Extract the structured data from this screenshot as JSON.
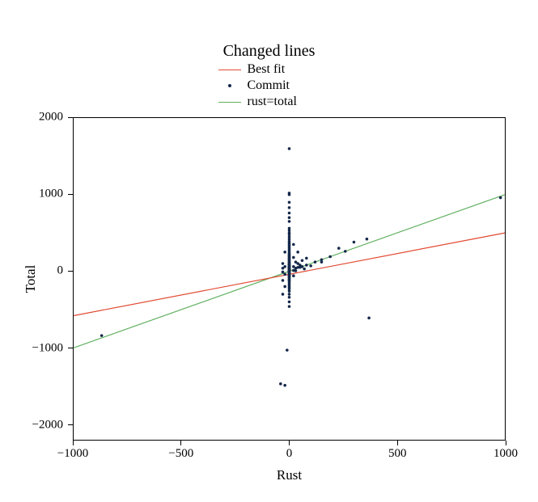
{
  "chart_data": {
    "type": "scatter",
    "title": "Changed lines",
    "xlabel": "Rust",
    "ylabel": "Total",
    "xlim": [
      -1000,
      1000
    ],
    "ylim": [
      -2200,
      2000
    ],
    "xticks": [
      -1000,
      -500,
      0,
      500,
      1000
    ],
    "yticks": [
      -2000,
      -1000,
      0,
      1000,
      2000
    ],
    "legend_position": "top-center",
    "series": [
      {
        "name": "Best fit",
        "type": "line",
        "color": "#e24a33",
        "points": [
          [
            -1000,
            -580
          ],
          [
            1000,
            500
          ]
        ]
      },
      {
        "name": "Commit",
        "type": "scatter",
        "color": "#15284b",
        "points": [
          [
            -870,
            -840
          ],
          [
            -40,
            -1470
          ],
          [
            -20,
            -1490
          ],
          [
            -10,
            -1030
          ],
          [
            0,
            1600
          ],
          [
            0,
            1020
          ],
          [
            0,
            1000
          ],
          [
            0,
            900
          ],
          [
            0,
            830
          ],
          [
            0,
            760
          ],
          [
            0,
            700
          ],
          [
            0,
            650
          ],
          [
            0,
            560
          ],
          [
            0,
            530
          ],
          [
            0,
            500
          ],
          [
            0,
            480
          ],
          [
            0,
            450
          ],
          [
            0,
            420
          ],
          [
            0,
            390
          ],
          [
            0,
            370
          ],
          [
            0,
            350
          ],
          [
            0,
            330
          ],
          [
            0,
            310
          ],
          [
            0,
            290
          ],
          [
            0,
            270
          ],
          [
            0,
            250
          ],
          [
            0,
            230
          ],
          [
            0,
            220
          ],
          [
            0,
            210
          ],
          [
            0,
            200
          ],
          [
            0,
            190
          ],
          [
            0,
            180
          ],
          [
            0,
            170
          ],
          [
            0,
            160
          ],
          [
            0,
            150
          ],
          [
            0,
            140
          ],
          [
            0,
            130
          ],
          [
            0,
            120
          ],
          [
            0,
            110
          ],
          [
            0,
            100
          ],
          [
            0,
            95
          ],
          [
            0,
            90
          ],
          [
            0,
            85
          ],
          [
            0,
            80
          ],
          [
            0,
            75
          ],
          [
            0,
            70
          ],
          [
            0,
            65
          ],
          [
            0,
            60
          ],
          [
            0,
            55
          ],
          [
            0,
            50
          ],
          [
            0,
            48
          ],
          [
            0,
            46
          ],
          [
            0,
            44
          ],
          [
            0,
            42
          ],
          [
            0,
            40
          ],
          [
            0,
            38
          ],
          [
            0,
            36
          ],
          [
            0,
            34
          ],
          [
            0,
            32
          ],
          [
            0,
            30
          ],
          [
            0,
            28
          ],
          [
            0,
            26
          ],
          [
            0,
            24
          ],
          [
            0,
            22
          ],
          [
            0,
            20
          ],
          [
            0,
            18
          ],
          [
            0,
            16
          ],
          [
            0,
            14
          ],
          [
            0,
            12
          ],
          [
            0,
            10
          ],
          [
            0,
            8
          ],
          [
            0,
            6
          ],
          [
            0,
            4
          ],
          [
            0,
            2
          ],
          [
            0,
            0
          ],
          [
            0,
            -2
          ],
          [
            0,
            -4
          ],
          [
            0,
            -6
          ],
          [
            0,
            -8
          ],
          [
            0,
            -10
          ],
          [
            0,
            -12
          ],
          [
            0,
            -14
          ],
          [
            0,
            -16
          ],
          [
            0,
            -18
          ],
          [
            0,
            -20
          ],
          [
            0,
            -25
          ],
          [
            0,
            -30
          ],
          [
            0,
            -35
          ],
          [
            0,
            -40
          ],
          [
            0,
            -45
          ],
          [
            0,
            -50
          ],
          [
            0,
            -55
          ],
          [
            0,
            -60
          ],
          [
            0,
            -70
          ],
          [
            0,
            -80
          ],
          [
            0,
            -90
          ],
          [
            0,
            -100
          ],
          [
            0,
            -110
          ],
          [
            0,
            -120
          ],
          [
            0,
            -130
          ],
          [
            0,
            -150
          ],
          [
            0,
            -170
          ],
          [
            0,
            -190
          ],
          [
            0,
            -210
          ],
          [
            0,
            -230
          ],
          [
            0,
            -260
          ],
          [
            0,
            -300
          ],
          [
            0,
            -340
          ],
          [
            0,
            -400
          ],
          [
            0,
            -460
          ],
          [
            -30,
            100
          ],
          [
            -30,
            40
          ],
          [
            -30,
            -10
          ],
          [
            -30,
            -120
          ],
          [
            -30,
            -300
          ],
          [
            -20,
            250
          ],
          [
            -20,
            60
          ],
          [
            -20,
            -40
          ],
          [
            -20,
            -200
          ],
          [
            20,
            350
          ],
          [
            20,
            180
          ],
          [
            20,
            60
          ],
          [
            20,
            10
          ],
          [
            20,
            -60
          ],
          [
            30,
            120
          ],
          [
            30,
            40
          ],
          [
            30,
            5
          ],
          [
            40,
            250
          ],
          [
            40,
            100
          ],
          [
            40,
            50
          ],
          [
            50,
            80
          ],
          [
            50,
            50
          ],
          [
            60,
            60
          ],
          [
            60,
            140
          ],
          [
            70,
            30
          ],
          [
            80,
            80
          ],
          [
            80,
            170
          ],
          [
            100,
            70
          ],
          [
            120,
            120
          ],
          [
            150,
            150
          ],
          [
            150,
            120
          ],
          [
            190,
            190
          ],
          [
            230,
            300
          ],
          [
            260,
            260
          ],
          [
            300,
            380
          ],
          [
            360,
            420
          ],
          [
            370,
            -610
          ],
          [
            980,
            960
          ]
        ]
      },
      {
        "name": "rust=total",
        "type": "line",
        "color": "#60b060",
        "points": [
          [
            -1000,
            -1000
          ],
          [
            1000,
            1000
          ]
        ]
      }
    ]
  },
  "colors": {
    "best_fit": "#e24a33",
    "commit": "#15284b",
    "identity": "#60b060",
    "axis": "#000000"
  },
  "legend": {
    "items": [
      {
        "label": "Best fit",
        "kind": "line",
        "colorKey": "best_fit"
      },
      {
        "label": "Commit",
        "kind": "dot",
        "colorKey": "commit"
      },
      {
        "label": "rust=total",
        "kind": "line",
        "colorKey": "identity"
      }
    ]
  },
  "tick_labels": {
    "x": [
      "−1000",
      "−500",
      "0",
      "500",
      "1000"
    ],
    "y": [
      "−2000",
      "−1000",
      "0",
      "1000",
      "2000"
    ]
  }
}
